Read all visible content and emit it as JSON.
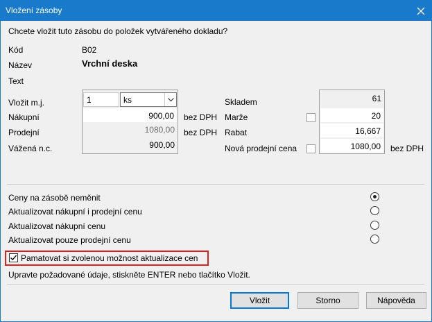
{
  "window": {
    "title": "Vložení zásoby"
  },
  "question": "Chcete vložit tuto zásobu do položek vytvářeného dokladu?",
  "info": {
    "kod_label": "Kód",
    "kod_value": "B02",
    "nazev_label": "Název",
    "nazev_value": "Vrchní deska",
    "text_label": "Text"
  },
  "left": {
    "vlozit_label": "Vložit m.j.",
    "qty_value": "1",
    "unit_value": "ks",
    "nakupni_label": "Nákupní",
    "nakupni_value": "900,00",
    "prodejni_label": "Prodejní",
    "prodejni_value": "1080,00",
    "vazena_label": "Vážená n.c.",
    "vazena_value": "900,00",
    "bez_dph_1": "bez DPH",
    "bez_dph_2": "bez DPH"
  },
  "right": {
    "skladem_label": "Skladem",
    "skladem_value": "61",
    "marze_label": "Marže",
    "marze_value": "20",
    "rabat_label": "Rabat",
    "rabat_value": "16,667",
    "nova_label": "Nová prodejní cena",
    "nova_value": "1080,00",
    "bez_dph_3": "bez DPH"
  },
  "options": [
    {
      "label": "Ceny na zásobě neměnit",
      "selected": true
    },
    {
      "label": "Aktualizovat nákupní i prodejní cenu",
      "selected": false
    },
    {
      "label": "Aktualizovat nákupní cenu",
      "selected": false
    },
    {
      "label": "Aktualizovat pouze prodejní cenu",
      "selected": false
    }
  ],
  "remember_label": "Pamatovat si zvolenou možnost aktualizace cen",
  "hint": "Upravte požadované údaje, stiskněte ENTER nebo tlačítko Vložit.",
  "buttons": {
    "vlozit": "Vložit",
    "storno": "Storno",
    "napoveda": "Nápověda"
  },
  "colors": {
    "titlebar": "#1979ca",
    "highlight_border": "#e02020"
  }
}
